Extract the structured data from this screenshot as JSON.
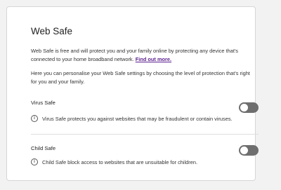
{
  "card": {
    "title": "Web Safe",
    "intro_text": "Web Safe is free and will protect you and your family online by protecting any device that's connected to your home broadband network.",
    "find_out_more": "Find out more.",
    "personalise_text": "Here you can personalise your Web Safe settings by choosing the level of protection that's right for you and your family."
  },
  "settings": [
    {
      "label": "Virus Safe",
      "description": "Virus Safe protects you against websites that may be fraudulent or contain viruses.",
      "enabled": false
    },
    {
      "label": "Child Safe",
      "description": "Child Safe block access to websites that are unsuitable for children.",
      "enabled": false
    }
  ],
  "icons": {
    "info": "info-icon"
  },
  "colors": {
    "link": "#5a1f8c",
    "toggle_off": "#6e6e6e"
  }
}
